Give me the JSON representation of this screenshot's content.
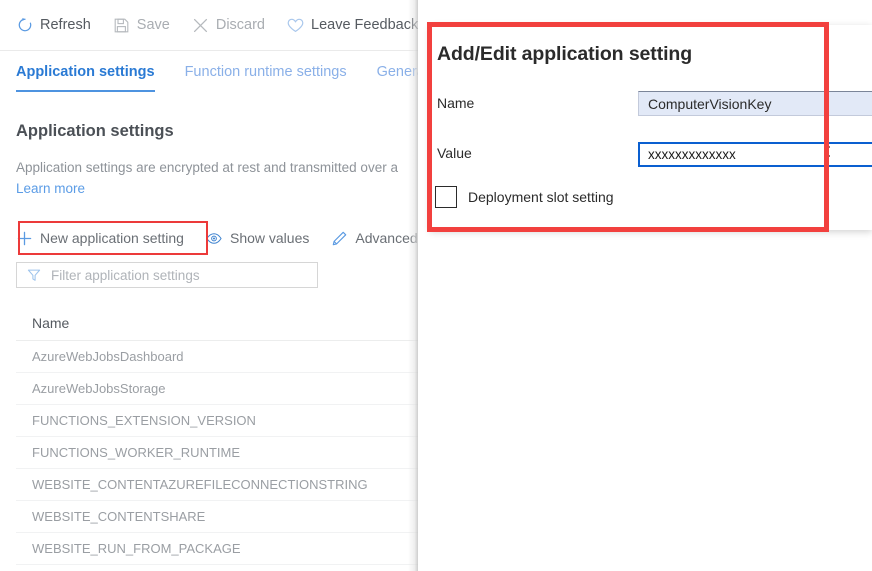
{
  "toolbar": {
    "items": [
      {
        "label": "Refresh",
        "icon": "refresh-icon",
        "disabled": false
      },
      {
        "label": "Save",
        "icon": "save-icon",
        "disabled": true
      },
      {
        "label": "Discard",
        "icon": "discard-icon",
        "disabled": true
      },
      {
        "label": "Leave Feedback",
        "icon": "heart-icon",
        "disabled": false
      }
    ]
  },
  "tabs": [
    {
      "label": "Application settings",
      "active": true
    },
    {
      "label": "Function runtime settings",
      "active": false
    },
    {
      "label": "General",
      "active": false
    }
  ],
  "section": {
    "title": "Application settings",
    "description": "Application settings are encrypted at rest and transmitted over a",
    "link": "Learn more"
  },
  "commands": [
    {
      "label": "New application setting",
      "icon": "plus-icon",
      "highlighted": true
    },
    {
      "label": "Show values",
      "icon": "eye-icon",
      "highlighted": false
    },
    {
      "label": "Advanced",
      "icon": "pencil-icon",
      "highlighted": false
    }
  ],
  "filter": {
    "placeholder": "Filter application settings",
    "value": "",
    "icon": "funnel-icon"
  },
  "table": {
    "columns": [
      "Name"
    ],
    "rows": [
      "AzureWebJobsDashboard",
      "AzureWebJobsStorage",
      "FUNCTIONS_EXTENSION_VERSION",
      "FUNCTIONS_WORKER_RUNTIME",
      "WEBSITE_CONTENTAZUREFILECONNECTIONSTRING",
      "WEBSITE_CONTENTSHARE",
      "WEBSITE_RUN_FROM_PACKAGE"
    ]
  },
  "dialog": {
    "title": "Add/Edit application setting",
    "name_label": "Name",
    "name_value": "ComputerVisionKey",
    "value_label": "Value",
    "value_value": "xxxxxxxxxxxxx",
    "checkbox_label": "Deployment slot setting",
    "checkbox_checked": false
  },
  "colors": {
    "accent_blue": "#2a7ad4",
    "tab_inactive": "#8ab0e8",
    "highlight_red": "#f2403e",
    "focus_border": "#0a5fd0",
    "name_field_fill": "#e2e9f7"
  }
}
